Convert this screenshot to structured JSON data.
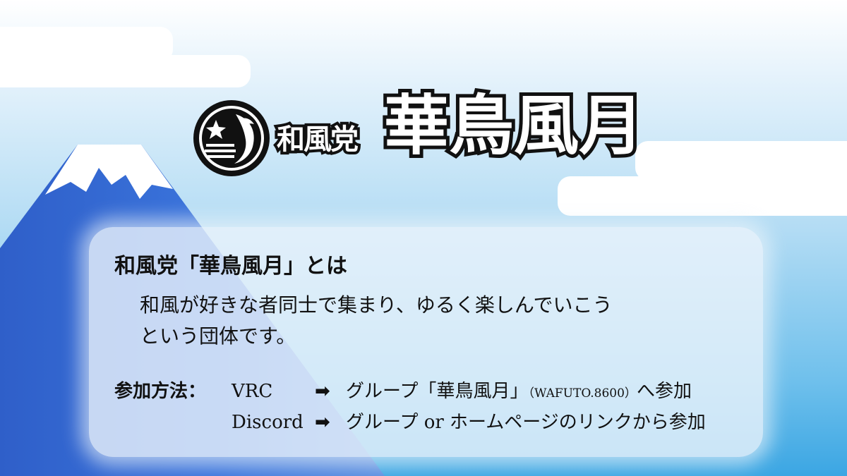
{
  "logo": {
    "party": "和風党",
    "name": "華鳥風月"
  },
  "about": {
    "heading": "和風党「華鳥風月」とは",
    "line1": "和風が好きな者同士で集まり、ゆるく楽しんでいこう",
    "line2": "という団体です。"
  },
  "join": {
    "label": "参加方法：",
    "rows": [
      {
        "platform": "VRC",
        "text_a": "グループ「華鳥風月」",
        "text_code": "（WAFUTO.8600）",
        "text_b": "へ参加"
      },
      {
        "platform": "Discord",
        "text_a": "グループ or ホームページのリンクから参加"
      }
    ]
  },
  "colors": {
    "sky_top": "#ffffff",
    "sky_bottom": "#3ba6e3",
    "mountain": "#3a6fd6",
    "snow": "#ffffff",
    "outline": "#111111"
  },
  "icons": {
    "arrow": "➡",
    "emblem": "sakura-wave-emblem"
  }
}
